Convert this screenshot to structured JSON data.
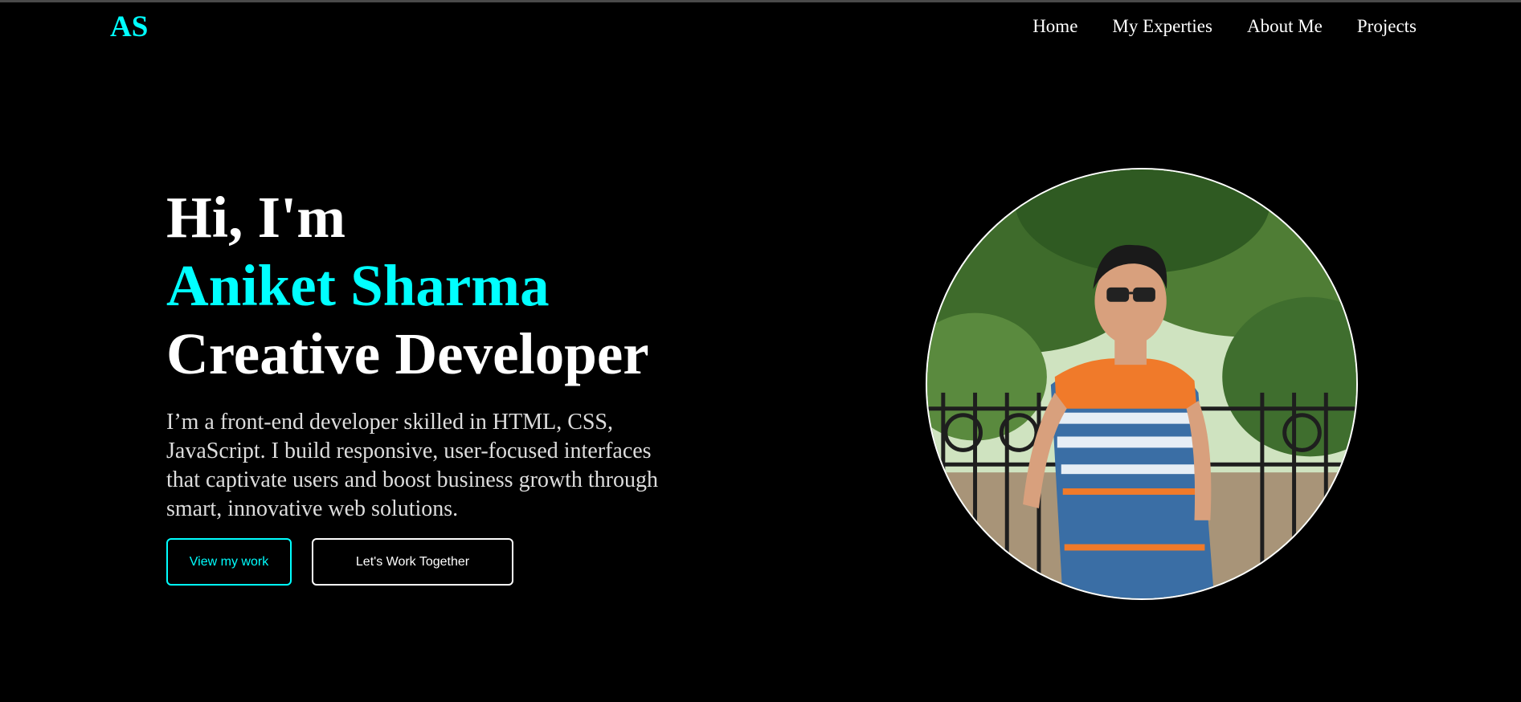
{
  "logo": "AS",
  "nav": [
    "Home",
    "My Experties",
    "About Me",
    "Projects"
  ],
  "hero": {
    "greeting": "Hi, I'm",
    "name": "Aniket Sharma",
    "role": "Creative Developer",
    "description": "I’m a front-end developer skilled in HTML, CSS, JavaScript. I build responsive, user-focused interfaces that captivate users and boost business growth through smart, innovative web solutions."
  },
  "buttons": {
    "primary": "View my work",
    "secondary": "Let's Work Together"
  },
  "colors": {
    "accent": "#00ffff",
    "background": "#000000",
    "text": "#ffffff"
  }
}
